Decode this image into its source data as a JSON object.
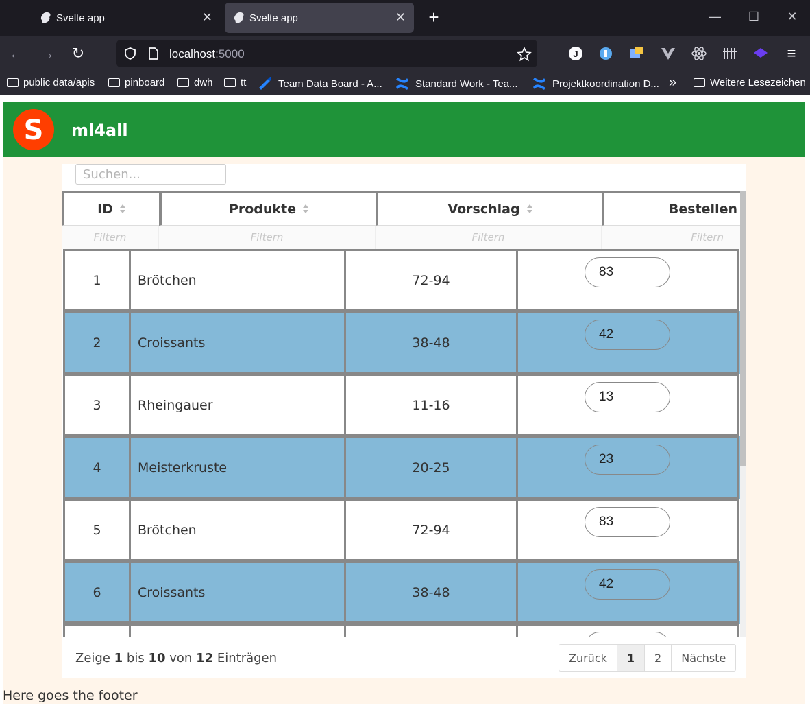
{
  "browser": {
    "tabs": [
      {
        "title": "Svelte app",
        "active": false
      },
      {
        "title": "Svelte app",
        "active": true
      }
    ],
    "url_host": "localhost",
    "url_port": ":5000",
    "bookmarks": [
      {
        "label": "public data/apis",
        "icon": "folder-icon"
      },
      {
        "label": "pinboard",
        "icon": "folder-icon"
      },
      {
        "label": "dwh",
        "icon": "folder-icon"
      },
      {
        "label": "tt",
        "icon": "folder-icon"
      },
      {
        "label": "Team Data Board - A...",
        "icon": "jira-icon"
      },
      {
        "label": "Standard Work - Tea...",
        "icon": "confluence-icon"
      },
      {
        "label": "Projektkoordination D...",
        "icon": "confluence-icon"
      },
      {
        "label": "Weitere Lesezeichen",
        "icon": "folder-icon"
      }
    ]
  },
  "app": {
    "title": "ml4all",
    "search_placeholder": "Suchen...",
    "columns": [
      {
        "label": "ID",
        "sortable": true
      },
      {
        "label": "Produkte",
        "sortable": true
      },
      {
        "label": "Vorschlag",
        "sortable": true
      },
      {
        "label": "Bestellen",
        "sortable": false
      }
    ],
    "filter_placeholder": "Filtern",
    "rows": [
      {
        "id": "1",
        "product": "Brötchen",
        "suggestion": "72-94",
        "order": "83"
      },
      {
        "id": "2",
        "product": "Croissants",
        "suggestion": "38-48",
        "order": "42"
      },
      {
        "id": "3",
        "product": "Rheingauer",
        "suggestion": "11-16",
        "order": "13"
      },
      {
        "id": "4",
        "product": "Meisterkruste",
        "suggestion": "20-25",
        "order": "23"
      },
      {
        "id": "5",
        "product": "Brötchen",
        "suggestion": "72-94",
        "order": "83"
      },
      {
        "id": "6",
        "product": "Croissants",
        "suggestion": "38-48",
        "order": "42"
      }
    ],
    "info": {
      "prefix": "Zeige",
      "from": "1",
      "mid1": "bis",
      "to": "10",
      "mid2": "von",
      "total": "12",
      "suffix": "Einträgen"
    },
    "pager": {
      "prev": "Zurück",
      "pages": [
        "1",
        "2"
      ],
      "current": "1",
      "next": "Nächste"
    },
    "footer": "Here goes the footer"
  },
  "colors": {
    "header": "#1f9339",
    "page_bg": "#fff5ea",
    "row_alt": "#84b9d8",
    "tab_active": "#42414d"
  }
}
